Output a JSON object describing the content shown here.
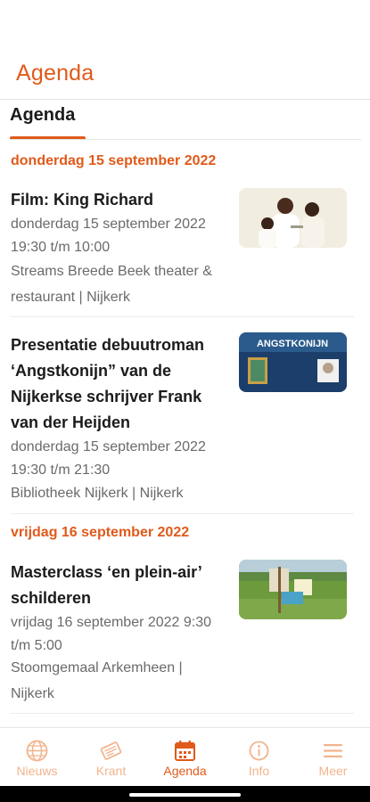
{
  "header": {
    "title": "Agenda"
  },
  "tabs": [
    {
      "label": "Agenda",
      "active": true
    }
  ],
  "colors": {
    "accent": "#e05a1a",
    "nav_inactive": "#f2b48e",
    "meta_text": "#6a6a6a"
  },
  "sections": [
    {
      "date": "donderdag 15 september 2022",
      "events": [
        {
          "title_lines": [
            "Film: King Richard"
          ],
          "meta_lines": [
            "donderdag 15 september 2022",
            "19:30 t/m 10:00"
          ],
          "location_lines": [
            "Streams Breede Beek theater &",
            "restaurant | Nijkerk"
          ]
        },
        {
          "title_lines": [
            "Presentatie debuutroman",
            "‘Angstkonijn” van de",
            "Nijkerkse schrijver Frank",
            "van der Heijden"
          ],
          "meta_lines": [
            "donderdag 15 september 2022",
            "19:30 t/m 21:30"
          ],
          "location_lines": [
            "Bibliotheek Nijkerk | Nijkerk"
          ],
          "thumb_text": "ANGSTKONIJN"
        }
      ]
    },
    {
      "date": "vrijdag 16 september 2022",
      "events": [
        {
          "title_lines": [
            "Masterclass ‘en plein-air’",
            "schilderen"
          ],
          "meta_lines": [
            "vrijdag 16 september 2022 9:30",
            "t/m 5:00"
          ],
          "location_lines": [
            "Stoomgemaal Arkemheen |",
            "Nijkerk"
          ]
        }
      ]
    }
  ],
  "bottom_nav": [
    {
      "label": "Nieuws",
      "icon": "globe-icon",
      "active": false
    },
    {
      "label": "Krant",
      "icon": "newspaper-icon",
      "active": false
    },
    {
      "label": "Agenda",
      "icon": "calendar-icon",
      "active": true
    },
    {
      "label": "Info",
      "icon": "info-icon",
      "active": false
    },
    {
      "label": "Meer",
      "icon": "menu-icon",
      "active": false
    }
  ]
}
